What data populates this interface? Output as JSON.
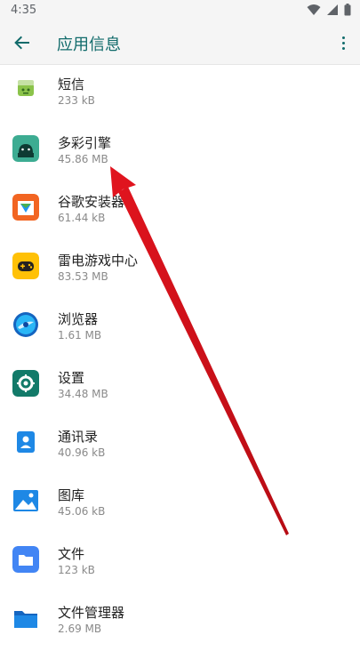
{
  "status": {
    "time": "4:35",
    "wifi_icon": "wifi-icon",
    "signal_icon": "signal-icon",
    "battery_icon": "battery-icon"
  },
  "appbar": {
    "title": "应用信息",
    "back_icon": "back-icon",
    "menu_icon": "overflow-menu-icon"
  },
  "apps": [
    {
      "name": "短信",
      "size": "233 kB",
      "icon": "messages-icon"
    },
    {
      "name": "多彩引擎",
      "size": "45.86 MB",
      "icon": "android-icon"
    },
    {
      "name": "谷歌安装器",
      "size": "61.44 kB",
      "icon": "installer-icon"
    },
    {
      "name": "雷电游戏中心",
      "size": "83.53 MB",
      "icon": "gamepad-icon"
    },
    {
      "name": "浏览器",
      "size": "1.61 MB",
      "icon": "browser-icon"
    },
    {
      "name": "设置",
      "size": "34.48 MB",
      "icon": "settings-icon"
    },
    {
      "name": "通讯录",
      "size": "40.96 kB",
      "icon": "contacts-icon"
    },
    {
      "name": "图库",
      "size": "45.06 kB",
      "icon": "gallery-icon"
    },
    {
      "name": "文件",
      "size": "123 kB",
      "icon": "files-icon"
    },
    {
      "name": "文件管理器",
      "size": "2.69 MB",
      "icon": "file-manager-icon"
    }
  ],
  "colors": {
    "accent": "#116b6b",
    "arrow": "#e0141e"
  }
}
